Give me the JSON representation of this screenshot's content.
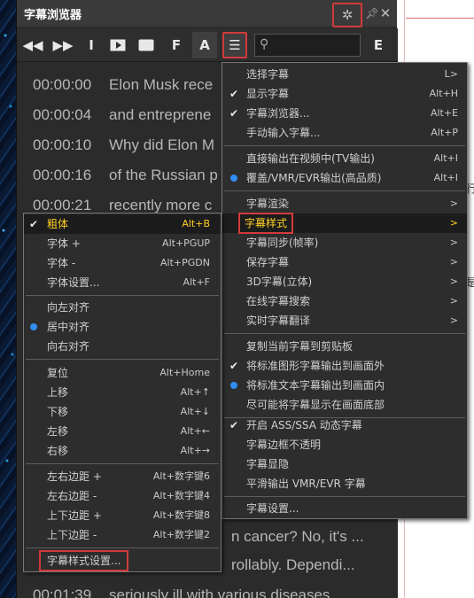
{
  "window": {
    "title": "字幕浏览器"
  },
  "titlebar_icons": [
    "gear-icon",
    "pin-icon",
    "close-icon"
  ],
  "toolbar": {
    "letters": {
      "f": "F",
      "a": "A",
      "e": "E"
    }
  },
  "search": {
    "placeholder": "",
    "value": ""
  },
  "subtitles": [
    {
      "time": "00:00:00",
      "text": "Elon Musk rece"
    },
    {
      "time": "00:00:04",
      "text": "and entreprene"
    },
    {
      "time": "00:00:10",
      "text": "Why did Elon M"
    },
    {
      "time": "00:00:16",
      "text": "of the Russian p"
    },
    {
      "time": "00:00:21",
      "text": "recently more c"
    },
    {
      "time": "",
      "text": "n cancer? No, it's ..."
    },
    {
      "time": "",
      "text": "rollably. Dependi..."
    },
    {
      "time": "00:01:39",
      "text": "seriously ill with various diseases"
    }
  ],
  "main_menu": {
    "items": [
      {
        "label": "选择字幕",
        "shortcut": "L>",
        "mark": ""
      },
      {
        "label": "显示字幕",
        "shortcut": "Alt+H",
        "mark": "check"
      },
      {
        "label": "字幕浏览器...",
        "shortcut": "Alt+E",
        "mark": "check"
      },
      {
        "label": "手动输入字幕...",
        "shortcut": "Alt+P",
        "mark": ""
      },
      {
        "label": "直接输出在视频中(TV输出)",
        "shortcut": "Alt+I",
        "mark": ""
      },
      {
        "label": "覆盖/VMR/EVR输出(高品质)",
        "shortcut": "Alt+I",
        "mark": "dot"
      },
      {
        "label": "字幕渲染",
        "shortcut": ">",
        "mark": ""
      },
      {
        "label": "字幕样式",
        "shortcut": ">",
        "mark": ""
      },
      {
        "label": "字幕同步(帧率)",
        "shortcut": ">",
        "mark": ""
      },
      {
        "label": "保存字幕",
        "shortcut": ">",
        "mark": ""
      },
      {
        "label": "3D字幕(立体)",
        "shortcut": ">",
        "mark": ""
      },
      {
        "label": "在线字幕搜索",
        "shortcut": ">",
        "mark": ""
      },
      {
        "label": "实时字幕翻译",
        "shortcut": ">",
        "mark": ""
      },
      {
        "label": "复制当前字幕到剪贴板",
        "shortcut": "",
        "mark": ""
      },
      {
        "label": "将标准图形字幕输出到画面外",
        "shortcut": "",
        "mark": "check"
      },
      {
        "label": "将标准文本字幕输出到画面内",
        "shortcut": "",
        "mark": "dot"
      },
      {
        "label": "尽可能将字幕显示在画面底部",
        "shortcut": "",
        "mark": ""
      },
      {
        "label": "开启 ASS/SSA 动态字幕",
        "shortcut": "",
        "mark": "check"
      },
      {
        "label": "字幕边框不透明",
        "shortcut": "",
        "mark": ""
      },
      {
        "label": "字幕显隐",
        "shortcut": "",
        "mark": ""
      },
      {
        "label": "平滑输出 VMR/EVR 字幕",
        "shortcut": "",
        "mark": ""
      },
      {
        "label": "字幕设置...",
        "shortcut": "",
        "mark": ""
      }
    ]
  },
  "style_menu": {
    "items": [
      {
        "label": "粗体",
        "shortcut": "Alt+B",
        "mark": "check"
      },
      {
        "label": "字体 +",
        "shortcut": "Alt+PGUP",
        "mark": ""
      },
      {
        "label": "字体 -",
        "shortcut": "Alt+PGDN",
        "mark": ""
      },
      {
        "label": "字体设置...",
        "shortcut": "Alt+F",
        "mark": ""
      },
      {
        "label": "向左对齐",
        "shortcut": "",
        "mark": ""
      },
      {
        "label": "居中对齐",
        "shortcut": "",
        "mark": "dot"
      },
      {
        "label": "向右对齐",
        "shortcut": "",
        "mark": ""
      },
      {
        "label": "复位",
        "shortcut": "Alt+Home",
        "mark": ""
      },
      {
        "label": "上移",
        "shortcut": "Alt+↑",
        "mark": ""
      },
      {
        "label": "下移",
        "shortcut": "Alt+↓",
        "mark": ""
      },
      {
        "label": "左移",
        "shortcut": "Alt+←",
        "mark": ""
      },
      {
        "label": "右移",
        "shortcut": "Alt+→",
        "mark": ""
      },
      {
        "label": "左右边距 +",
        "shortcut": "Alt+数字键6",
        "mark": ""
      },
      {
        "label": "左右边距 -",
        "shortcut": "Alt+数字键4",
        "mark": ""
      },
      {
        "label": "上下边距 +",
        "shortcut": "Alt+数字键8",
        "mark": ""
      },
      {
        "label": "上下边距 -",
        "shortcut": "Alt+数字键2",
        "mark": ""
      },
      {
        "label": "字幕样式设置...",
        "shortcut": "",
        "mark": ""
      }
    ]
  },
  "background_doc": {
    "chars": [
      "行",
      "是"
    ]
  },
  "colors": {
    "highlight_text": "#ffd024",
    "annotation_box": "#d23a3a",
    "radio_dot": "#2f8ef0"
  }
}
